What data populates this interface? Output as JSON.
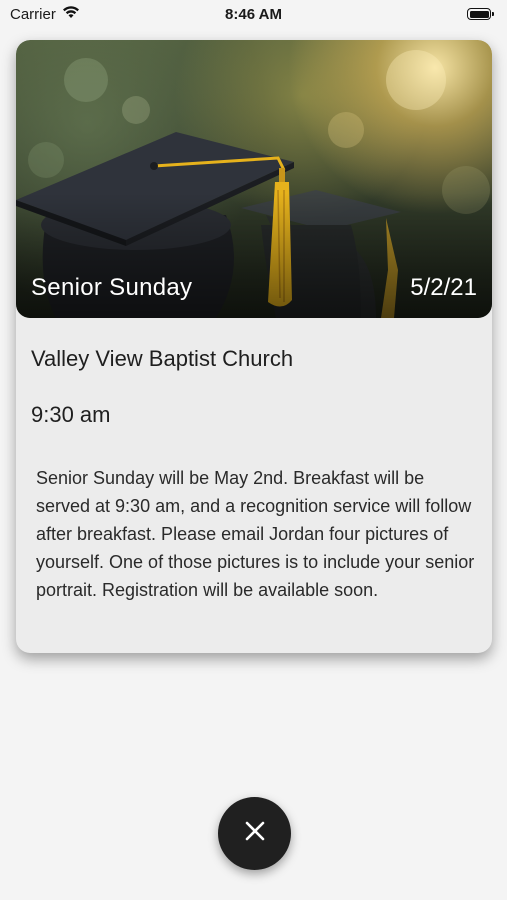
{
  "status_bar": {
    "carrier": "Carrier",
    "time": "8:46 AM"
  },
  "event": {
    "title": "Senior Sunday",
    "date": "5/2/21",
    "venue": "Valley View Baptist Church",
    "time": "9:30 am",
    "description": "Senior Sunday will be May 2nd. Breakfast will be served at 9:30 am, and a recognition service will follow after breakfast. Please email Jordan four pictures of yourself. One of those pictures is to include your senior portrait. Registration will be available soon."
  },
  "icons": {
    "signal": "wifi-icon",
    "battery": "battery-icon",
    "close": "close-icon",
    "hero_image": "graduation-caps-photo"
  },
  "colors": {
    "background": "#f4f4f4",
    "card": "#ececec",
    "close_button": "#202020",
    "tassel": "#e6b21c"
  }
}
